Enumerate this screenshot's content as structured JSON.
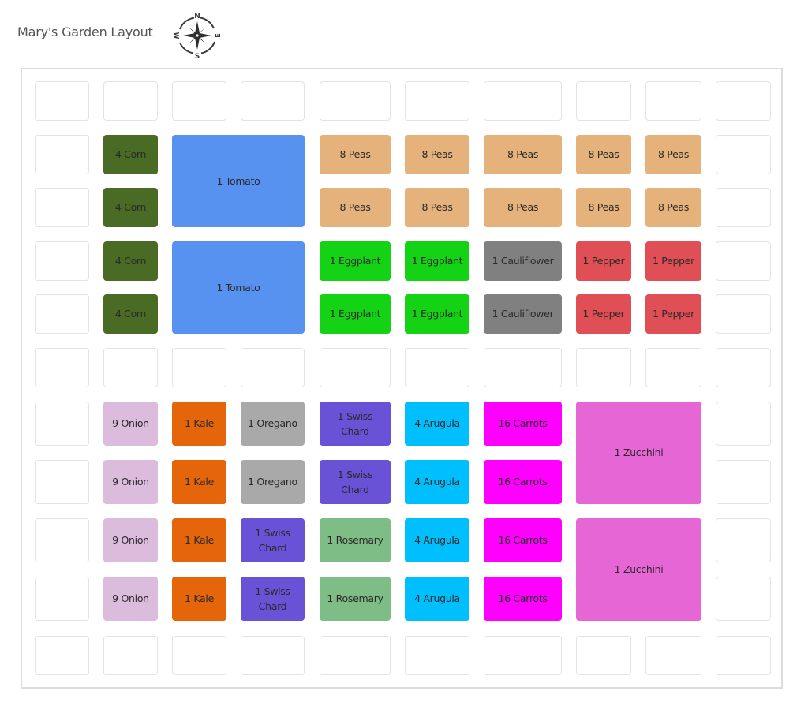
{
  "header": {
    "title": "Mary's Garden Layout",
    "compass": {
      "icon": "compass-rose-icon",
      "north": "N",
      "south": "S",
      "east": "E",
      "west": "W"
    }
  },
  "plants": {
    "corn": {
      "name": "Corn",
      "color": "#4a6b24"
    },
    "tomato": {
      "name": "Tomato",
      "color": "#5792f0"
    },
    "peas": {
      "name": "Peas",
      "color": "#e4b27a"
    },
    "eggplant": {
      "name": "Eggplant",
      "color": "#14d214"
    },
    "cauliflower": {
      "name": "Cauliflower",
      "color": "#808080"
    },
    "pepper": {
      "name": "Pepper",
      "color": "#df4f55"
    },
    "onion": {
      "name": "Onion",
      "color": "#dcbcdc"
    },
    "kale": {
      "name": "Kale",
      "color": "#e4650a"
    },
    "oregano": {
      "name": "Oregano",
      "color": "#a9a9a9"
    },
    "swiss_chard": {
      "name": "Swiss Chard",
      "color": "#6a52d6"
    },
    "arugula": {
      "name": "Arugula",
      "color": "#00bfff"
    },
    "carrots": {
      "name": "Carrots",
      "color": "#ff00ff"
    },
    "rosemary": {
      "name": "Rosemary",
      "color": "#7fbd86"
    },
    "zucchini": {
      "name": "Zucchini",
      "color": "#e766d6"
    }
  },
  "grid": {
    "columns": 10,
    "rows": 11,
    "beds": [
      {
        "label": "4 Corn",
        "plant": "corn",
        "col": 1,
        "row": 1,
        "colspan": 1,
        "rowspan": 1
      },
      {
        "label": "4 Corn",
        "plant": "corn",
        "col": 1,
        "row": 2,
        "colspan": 1,
        "rowspan": 1
      },
      {
        "label": "4 Corn",
        "plant": "corn",
        "col": 1,
        "row": 3,
        "colspan": 1,
        "rowspan": 1
      },
      {
        "label": "4 Corn",
        "plant": "corn",
        "col": 1,
        "row": 4,
        "colspan": 1,
        "rowspan": 1
      },
      {
        "label": "1 Tomato",
        "plant": "tomato",
        "col": 2,
        "row": 1,
        "colspan": 2,
        "rowspan": 2
      },
      {
        "label": "1 Tomato",
        "plant": "tomato",
        "col": 2,
        "row": 3,
        "colspan": 2,
        "rowspan": 2
      },
      {
        "label": "8 Peas",
        "plant": "peas",
        "col": 4,
        "row": 1,
        "colspan": 1,
        "rowspan": 1
      },
      {
        "label": "8 Peas",
        "plant": "peas",
        "col": 5,
        "row": 1,
        "colspan": 1,
        "rowspan": 1
      },
      {
        "label": "8 Peas",
        "plant": "peas",
        "col": 6,
        "row": 1,
        "colspan": 1,
        "rowspan": 1
      },
      {
        "label": "8 Peas",
        "plant": "peas",
        "col": 7,
        "row": 1,
        "colspan": 1,
        "rowspan": 1
      },
      {
        "label": "8 Peas",
        "plant": "peas",
        "col": 8,
        "row": 1,
        "colspan": 1,
        "rowspan": 1
      },
      {
        "label": "8 Peas",
        "plant": "peas",
        "col": 4,
        "row": 2,
        "colspan": 1,
        "rowspan": 1
      },
      {
        "label": "8 Peas",
        "plant": "peas",
        "col": 5,
        "row": 2,
        "colspan": 1,
        "rowspan": 1
      },
      {
        "label": "8 Peas",
        "plant": "peas",
        "col": 6,
        "row": 2,
        "colspan": 1,
        "rowspan": 1
      },
      {
        "label": "8 Peas",
        "plant": "peas",
        "col": 7,
        "row": 2,
        "colspan": 1,
        "rowspan": 1
      },
      {
        "label": "8 Peas",
        "plant": "peas",
        "col": 8,
        "row": 2,
        "colspan": 1,
        "rowspan": 1
      },
      {
        "label": "1 Eggplant",
        "plant": "eggplant",
        "col": 4,
        "row": 3,
        "colspan": 1,
        "rowspan": 1
      },
      {
        "label": "1 Eggplant",
        "plant": "eggplant",
        "col": 5,
        "row": 3,
        "colspan": 1,
        "rowspan": 1
      },
      {
        "label": "1 Eggplant",
        "plant": "eggplant",
        "col": 4,
        "row": 4,
        "colspan": 1,
        "rowspan": 1
      },
      {
        "label": "1 Eggplant",
        "plant": "eggplant",
        "col": 5,
        "row": 4,
        "colspan": 1,
        "rowspan": 1
      },
      {
        "label": "1 Cauliflower",
        "plant": "cauliflower",
        "col": 6,
        "row": 3,
        "colspan": 1,
        "rowspan": 1
      },
      {
        "label": "1 Cauliflower",
        "plant": "cauliflower",
        "col": 6,
        "row": 4,
        "colspan": 1,
        "rowspan": 1
      },
      {
        "label": "1 Pepper",
        "plant": "pepper",
        "col": 7,
        "row": 3,
        "colspan": 1,
        "rowspan": 1
      },
      {
        "label": "1 Pepper",
        "plant": "pepper",
        "col": 8,
        "row": 3,
        "colspan": 1,
        "rowspan": 1
      },
      {
        "label": "1 Pepper",
        "plant": "pepper",
        "col": 7,
        "row": 4,
        "colspan": 1,
        "rowspan": 1
      },
      {
        "label": "1 Pepper",
        "plant": "pepper",
        "col": 8,
        "row": 4,
        "colspan": 1,
        "rowspan": 1
      },
      {
        "label": "9 Onion",
        "plant": "onion",
        "col": 1,
        "row": 6,
        "colspan": 1,
        "rowspan": 1
      },
      {
        "label": "9 Onion",
        "plant": "onion",
        "col": 1,
        "row": 7,
        "colspan": 1,
        "rowspan": 1
      },
      {
        "label": "9 Onion",
        "plant": "onion",
        "col": 1,
        "row": 8,
        "colspan": 1,
        "rowspan": 1
      },
      {
        "label": "9 Onion",
        "plant": "onion",
        "col": 1,
        "row": 9,
        "colspan": 1,
        "rowspan": 1
      },
      {
        "label": "1 Kale",
        "plant": "kale",
        "col": 2,
        "row": 6,
        "colspan": 1,
        "rowspan": 1
      },
      {
        "label": "1 Kale",
        "plant": "kale",
        "col": 2,
        "row": 7,
        "colspan": 1,
        "rowspan": 1
      },
      {
        "label": "1 Kale",
        "plant": "kale",
        "col": 2,
        "row": 8,
        "colspan": 1,
        "rowspan": 1
      },
      {
        "label": "1 Kale",
        "plant": "kale",
        "col": 2,
        "row": 9,
        "colspan": 1,
        "rowspan": 1
      },
      {
        "label": "1 Oregano",
        "plant": "oregano",
        "col": 3,
        "row": 6,
        "colspan": 1,
        "rowspan": 1
      },
      {
        "label": "1 Oregano",
        "plant": "oregano",
        "col": 3,
        "row": 7,
        "colspan": 1,
        "rowspan": 1
      },
      {
        "label": "1 Swiss Chard",
        "plant": "swiss_chard",
        "col": 3,
        "row": 8,
        "colspan": 1,
        "rowspan": 1
      },
      {
        "label": "1 Swiss Chard",
        "plant": "swiss_chard",
        "col": 3,
        "row": 9,
        "colspan": 1,
        "rowspan": 1
      },
      {
        "label": "1 Swiss Chard",
        "plant": "swiss_chard",
        "col": 4,
        "row": 6,
        "colspan": 1,
        "rowspan": 1
      },
      {
        "label": "1 Swiss Chard",
        "plant": "swiss_chard",
        "col": 4,
        "row": 7,
        "colspan": 1,
        "rowspan": 1
      },
      {
        "label": "1 Rosemary",
        "plant": "rosemary",
        "col": 4,
        "row": 8,
        "colspan": 1,
        "rowspan": 1
      },
      {
        "label": "1 Rosemary",
        "plant": "rosemary",
        "col": 4,
        "row": 9,
        "colspan": 1,
        "rowspan": 1
      },
      {
        "label": "4 Arugula",
        "plant": "arugula",
        "col": 5,
        "row": 6,
        "colspan": 1,
        "rowspan": 1
      },
      {
        "label": "4 Arugula",
        "plant": "arugula",
        "col": 5,
        "row": 7,
        "colspan": 1,
        "rowspan": 1
      },
      {
        "label": "4 Arugula",
        "plant": "arugula",
        "col": 5,
        "row": 8,
        "colspan": 1,
        "rowspan": 1
      },
      {
        "label": "4 Arugula",
        "plant": "arugula",
        "col": 5,
        "row": 9,
        "colspan": 1,
        "rowspan": 1
      },
      {
        "label": "16 Carrots",
        "plant": "carrots",
        "col": 6,
        "row": 6,
        "colspan": 1,
        "rowspan": 1
      },
      {
        "label": "16 Carrots",
        "plant": "carrots",
        "col": 6,
        "row": 7,
        "colspan": 1,
        "rowspan": 1
      },
      {
        "label": "16 Carrots",
        "plant": "carrots",
        "col": 6,
        "row": 8,
        "colspan": 1,
        "rowspan": 1
      },
      {
        "label": "16 Carrots",
        "plant": "carrots",
        "col": 6,
        "row": 9,
        "colspan": 1,
        "rowspan": 1
      },
      {
        "label": "1 Zucchini",
        "plant": "zucchini",
        "col": 7,
        "row": 6,
        "colspan": 2,
        "rowspan": 2
      },
      {
        "label": "1 Zucchini",
        "plant": "zucchini",
        "col": 7,
        "row": 8,
        "colspan": 2,
        "rowspan": 2
      }
    ]
  }
}
